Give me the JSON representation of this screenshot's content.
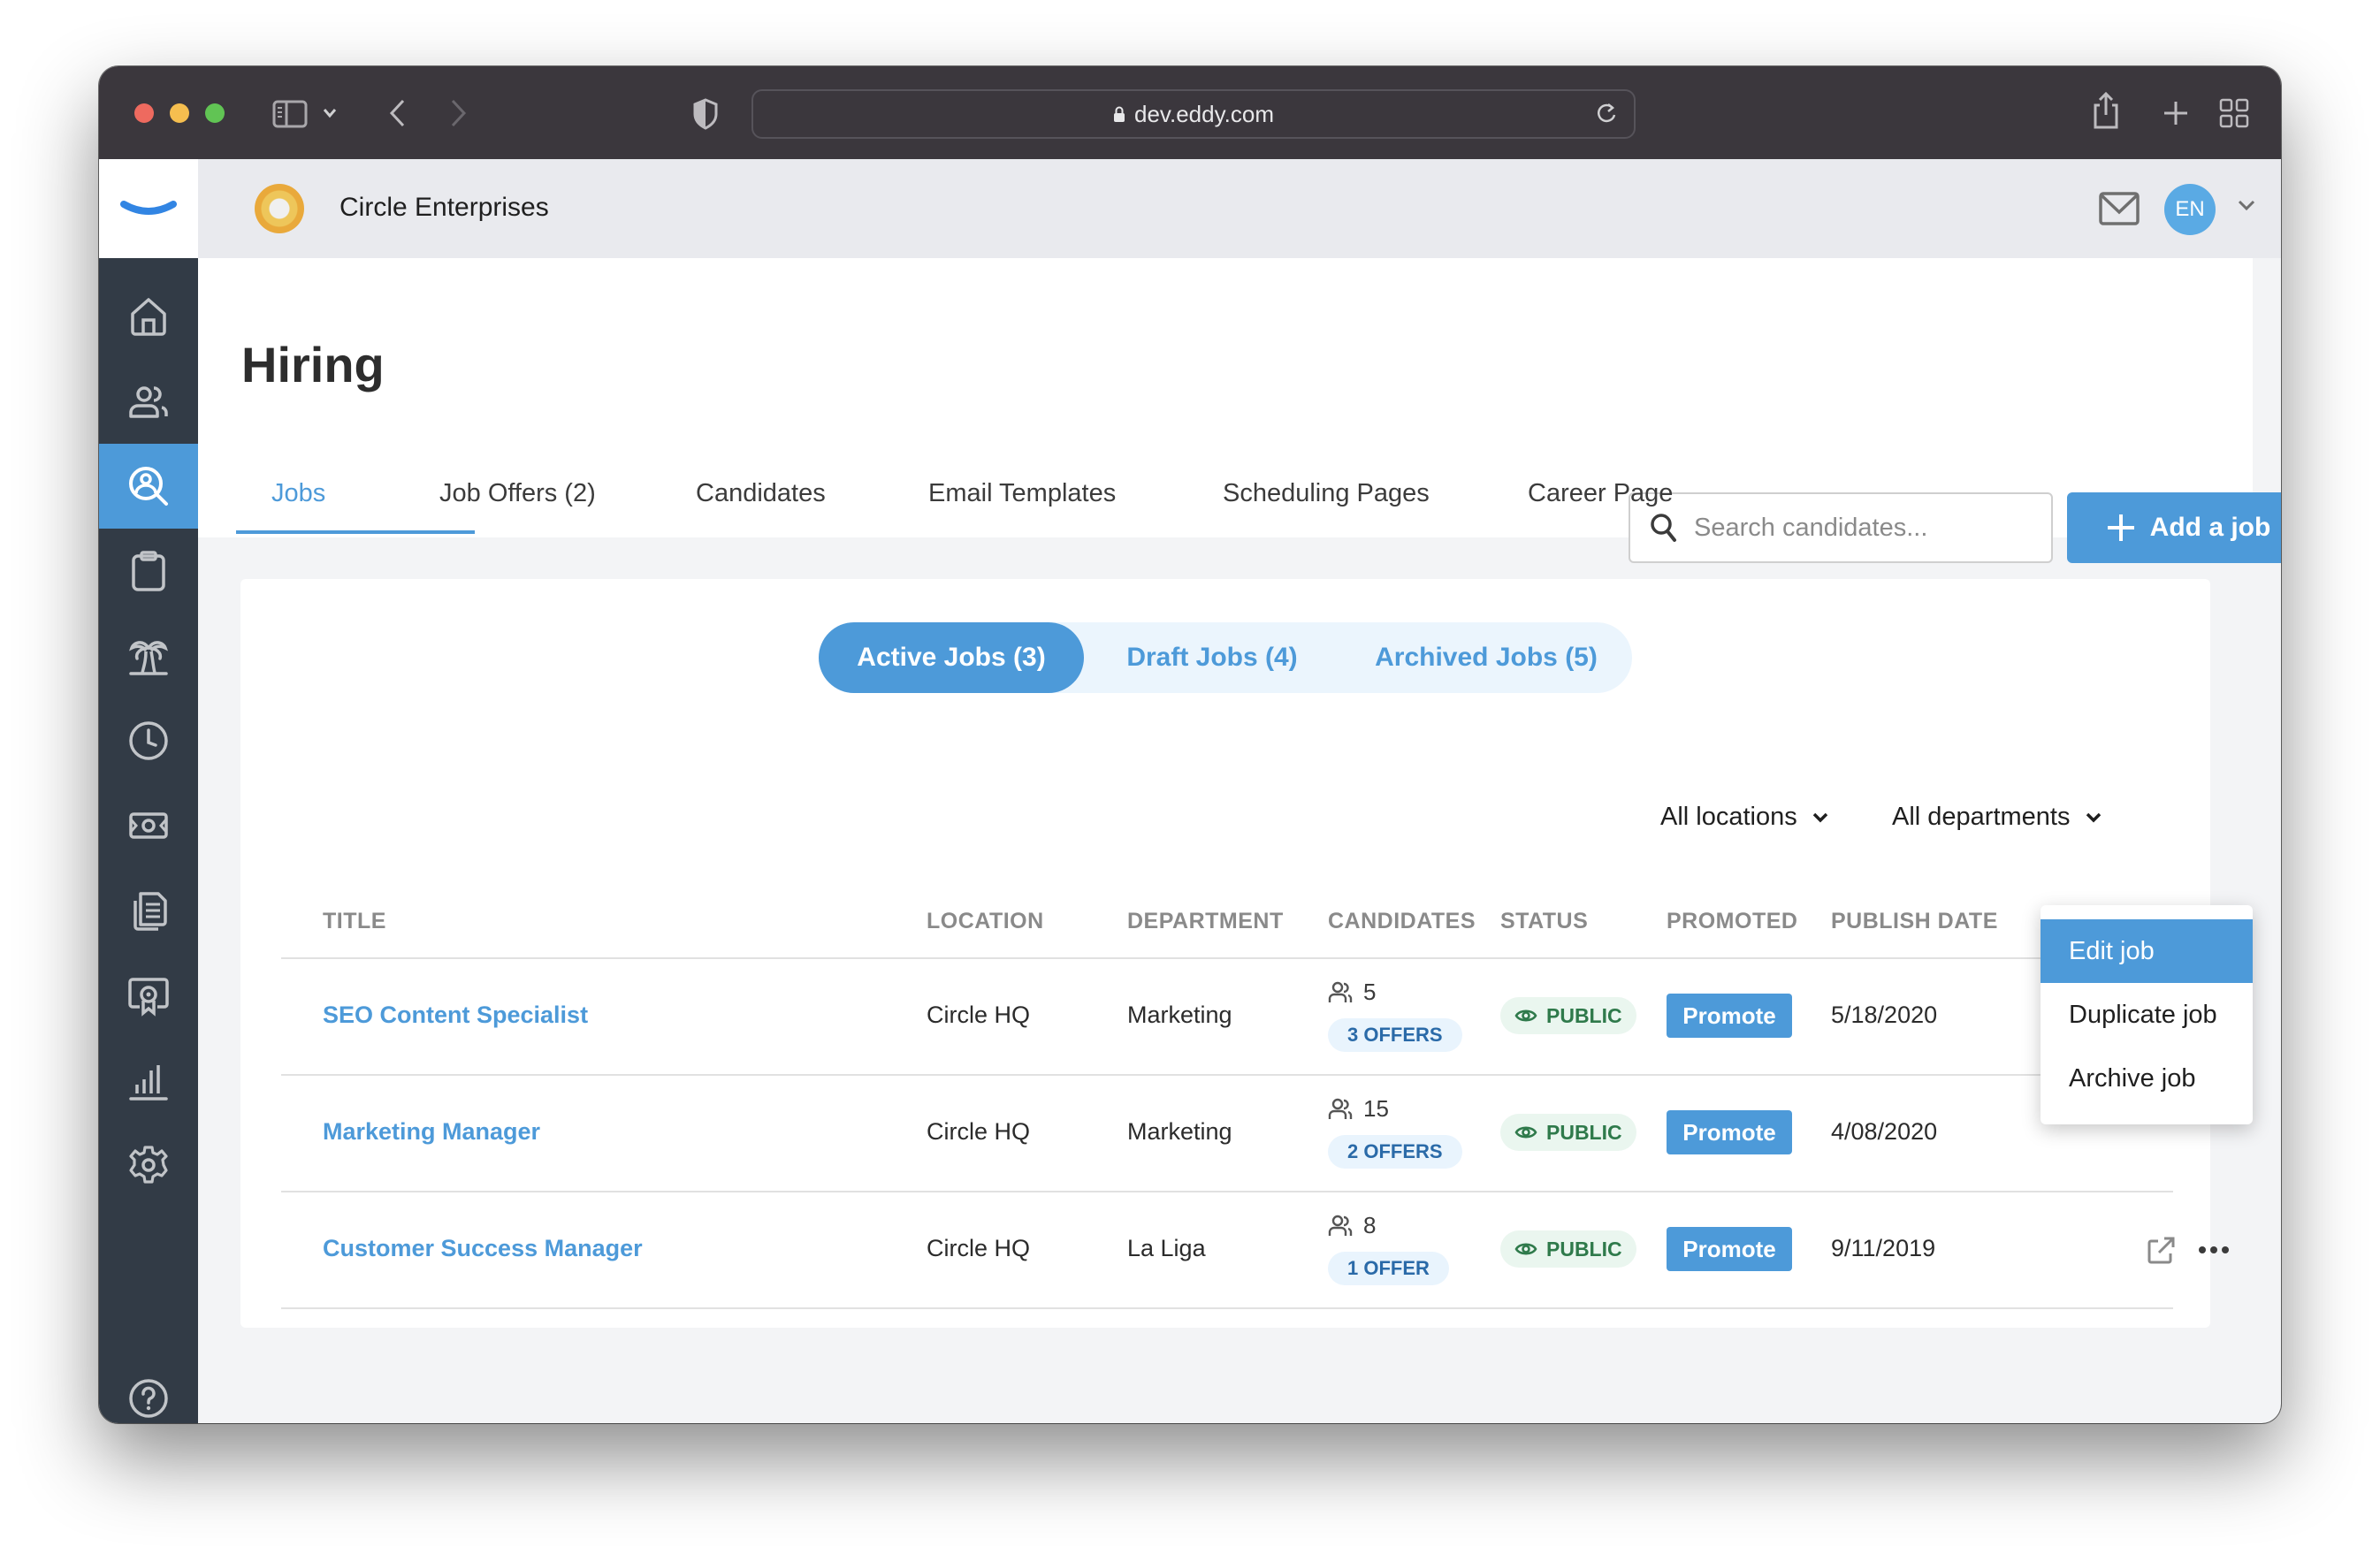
{
  "browser": {
    "url": "dev.eddy.com"
  },
  "header": {
    "company_name": "Circle Enterprises",
    "avatar_initials": "EN"
  },
  "sidebar": {
    "items": [
      {
        "name": "home",
        "active": false
      },
      {
        "name": "people",
        "active": false
      },
      {
        "name": "hiring",
        "active": true
      },
      {
        "name": "clipboard",
        "active": false
      },
      {
        "name": "time-off",
        "active": false
      },
      {
        "name": "time-tracking",
        "active": false
      },
      {
        "name": "payroll",
        "active": false
      },
      {
        "name": "documents",
        "active": false
      },
      {
        "name": "training",
        "active": false
      },
      {
        "name": "reports",
        "active": false
      },
      {
        "name": "settings",
        "active": false
      }
    ],
    "help": "help"
  },
  "page": {
    "title": "Hiring",
    "search_placeholder": "Search candidates...",
    "add_button": "Add a job"
  },
  "tabs": [
    {
      "label": "Jobs",
      "active": true
    },
    {
      "label": "Job Offers (2)",
      "active": false
    },
    {
      "label": "Candidates",
      "active": false
    },
    {
      "label": "Email Templates",
      "active": false
    },
    {
      "label": "Scheduling Pages",
      "active": false
    },
    {
      "label": "Career Page",
      "active": false
    }
  ],
  "segments": [
    {
      "label": "Active Jobs (3)",
      "active": true
    },
    {
      "label": "Draft Jobs (4)",
      "active": false
    },
    {
      "label": "Archived Jobs (5)",
      "active": false
    }
  ],
  "filters": {
    "location": "All locations",
    "department": "All departments"
  },
  "table": {
    "columns": [
      "TITLE",
      "LOCATION",
      "DEPARTMENT",
      "CANDIDATES",
      "STATUS",
      "PROMOTED",
      "PUBLISH DATE"
    ],
    "rows": [
      {
        "title": "SEO Content Specialist",
        "location": "Circle HQ",
        "department": "Marketing",
        "candidates": "5",
        "offers": "3 OFFERS",
        "status": "PUBLIC",
        "promote": "Promote",
        "publish_date": "5/18/2020"
      },
      {
        "title": "Marketing Manager",
        "location": "Circle HQ",
        "department": "Marketing",
        "candidates": "15",
        "offers": "2 OFFERS",
        "status": "PUBLIC",
        "promote": "Promote",
        "publish_date": "4/08/2020"
      },
      {
        "title": "Customer Success Manager",
        "location": "Circle HQ",
        "department": "La Liga",
        "candidates": "8",
        "offers": "1 OFFER",
        "status": "PUBLIC",
        "promote": "Promote",
        "publish_date": "9/11/2019"
      }
    ]
  },
  "context_menu": {
    "items": [
      {
        "label": "Edit job",
        "active": true
      },
      {
        "label": "Duplicate job",
        "active": false
      },
      {
        "label": "Archive job",
        "active": false
      }
    ]
  },
  "colors": {
    "accent": "#4d9ad9",
    "sidebar": "#323b46",
    "status_green": "#2f7a4b",
    "offer_blue": "#2a6aa8"
  }
}
